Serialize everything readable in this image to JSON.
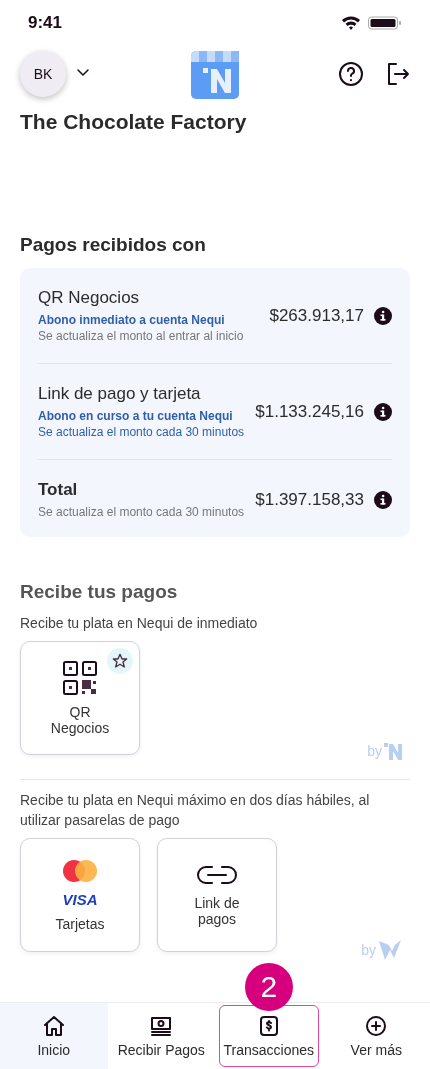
{
  "status_bar": {
    "time": "9:41"
  },
  "header": {
    "avatar": "BK",
    "business": "The Chocolate Factory"
  },
  "payments": {
    "title": "Pagos recibidos con",
    "rows": [
      {
        "kind": "method",
        "name": "QR Negocios",
        "note": "Abono inmediato a cuenta Nequi",
        "update": "Se actualiza el monto al entrar al inicio",
        "update_highlight": false,
        "amount": "$263.913,17"
      },
      {
        "kind": "method",
        "name": "Link de pago y tarjeta",
        "note": "Abono en curso a tu cuenta Nequi",
        "update": "Se actualiza el monto cada 30 minutos",
        "update_highlight": true,
        "amount": "$1.133.245,16"
      },
      {
        "kind": "total",
        "name": "Total",
        "update": "Se actualiza el monto cada 30 minutos",
        "update_highlight": false,
        "amount": "$1.397.158,33"
      }
    ]
  },
  "receive": {
    "title": "Recibe tus pagos",
    "groups": [
      {
        "description": "Recibe tu plata en Nequi de inmediato",
        "provider": {
          "kind": "nequi",
          "by": "by"
        },
        "options": [
          {
            "kind": "qr",
            "label": "QR Negocios",
            "favorite": true
          }
        ]
      },
      {
        "description": "Recibe tu plata en Nequi máximo en dos días hábiles, al utilizar pasarelas de pago",
        "provider": {
          "kind": "wompi",
          "by": "by"
        },
        "options": [
          {
            "kind": "cards",
            "label": "Tarjetas",
            "brand": "VISA",
            "favorite": false
          },
          {
            "kind": "link",
            "label": "Link de pagos",
            "favorite": false
          }
        ]
      }
    ]
  },
  "nav": [
    {
      "kind": "home",
      "label": "Inicio",
      "selected": true,
      "highlighted": false
    },
    {
      "kind": "cash",
      "label": "Recibir Pagos",
      "selected": false,
      "highlighted": false
    },
    {
      "kind": "dollar",
      "label": "Transacciones",
      "selected": false,
      "highlighted": true,
      "badge": "2"
    },
    {
      "kind": "plus",
      "label": "Ver más",
      "selected": false,
      "highlighted": false
    }
  ]
}
